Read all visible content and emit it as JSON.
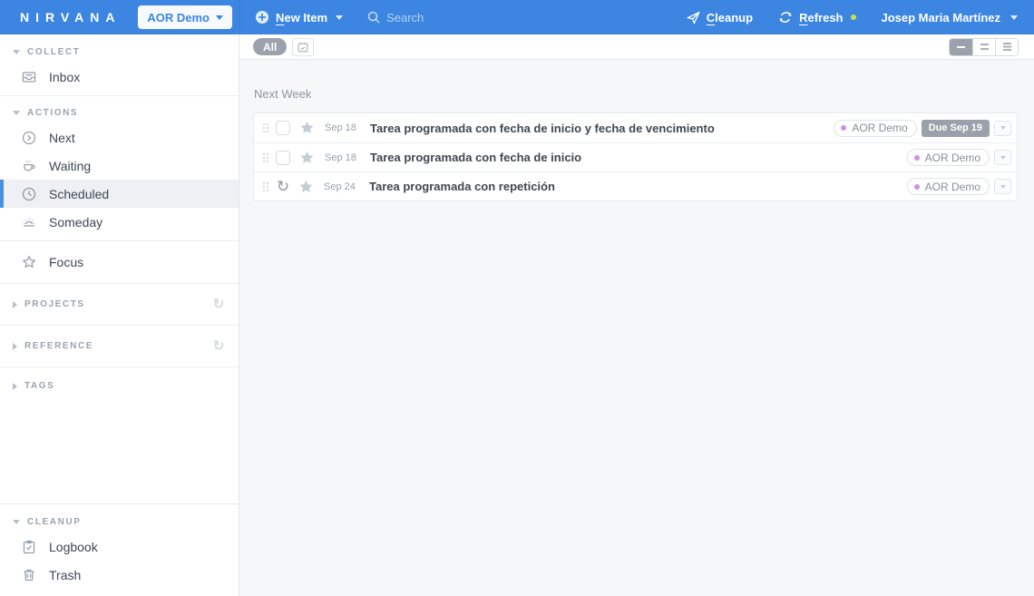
{
  "topbar": {
    "logo": "NIRVANA",
    "workspace": "AOR Demo",
    "new_item": {
      "accel": "N",
      "rest": "ew Item"
    },
    "search_placeholder": "Search",
    "cleanup": {
      "accel": "C",
      "rest": "leanup"
    },
    "refresh": {
      "accel": "R",
      "rest": "efresh"
    },
    "user": "Josep Maria Martínez"
  },
  "sidebar": {
    "collect": {
      "header": "COLLECT",
      "items": [
        {
          "label": "Inbox",
          "icon": "inbox-icon"
        }
      ]
    },
    "actions": {
      "header": "ACTIONS",
      "items": [
        {
          "label": "Next",
          "icon": "next-icon"
        },
        {
          "label": "Waiting",
          "icon": "waiting-icon"
        },
        {
          "label": "Scheduled",
          "icon": "scheduled-icon",
          "selected": true
        },
        {
          "label": "Someday",
          "icon": "someday-icon"
        }
      ]
    },
    "focus": {
      "label": "Focus",
      "icon": "star-icon"
    },
    "projects": {
      "header": "PROJECTS",
      "right_icon": "cycle-icon"
    },
    "reference": {
      "header": "REFERENCE",
      "right_icon": "cycle-icon"
    },
    "tags": {
      "header": "TAGS"
    },
    "cleanup": {
      "header": "CLEANUP",
      "items": [
        {
          "label": "Logbook",
          "icon": "logbook-icon"
        },
        {
          "label": "Trash",
          "icon": "trash-icon"
        }
      ]
    }
  },
  "main": {
    "filterbar": {
      "all_label": "All"
    },
    "group_header": "Next Week",
    "tasks": [
      {
        "date": "Sep 18",
        "title": "Tarea programada con fecha de inicio y fecha de vencimiento",
        "tag": "AOR Demo",
        "due": "Due Sep 19",
        "leading": "checkbox"
      },
      {
        "date": "Sep 18",
        "title": "Tarea programada con fecha de inicio",
        "tag": "AOR Demo",
        "leading": "checkbox"
      },
      {
        "date": "Sep 24",
        "title": "Tarea programada con repetición",
        "tag": "AOR Demo",
        "leading": "repeat"
      }
    ],
    "repeat_glyph": "↻",
    "cycle_glyph": "↻"
  },
  "colors": {
    "topbar_blue": "#3c86e1",
    "accent": "#4a90e2",
    "due_badge": "#9aa1ab",
    "tag_dot": "#d08fe3",
    "refresh_dot": "#c9df53",
    "selected_row_bg": "#eef0f3"
  }
}
